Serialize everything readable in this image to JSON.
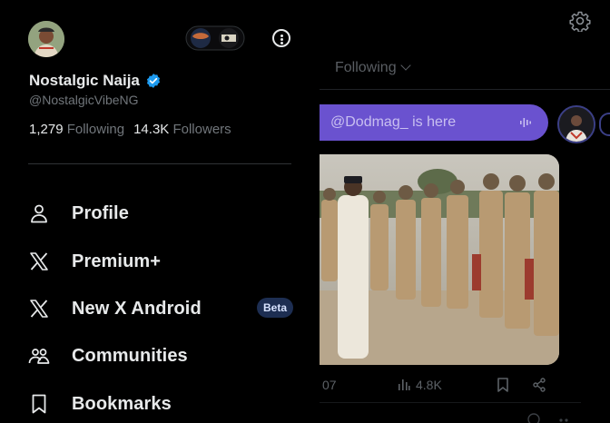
{
  "profile": {
    "display_name": "Nostalgic Naija",
    "handle": "@NostalgicVibeNG",
    "following_count": "1,279",
    "following_label": "Following",
    "followers_count": "14.3K",
    "followers_label": "Followers",
    "verified": true,
    "verified_color": "#1d9bf0"
  },
  "menu": {
    "items": [
      {
        "label": "Profile",
        "icon": "person-icon"
      },
      {
        "label": "Premium+",
        "icon": "x-logo-icon"
      },
      {
        "label": "New X Android",
        "icon": "x-logo-icon",
        "badge": "Beta"
      },
      {
        "label": "Communities",
        "icon": "communities-icon"
      },
      {
        "label": "Bookmarks",
        "icon": "bookmark-icon"
      }
    ]
  },
  "feed": {
    "tab_label": "Following",
    "space_banner": "@Dodmag_ is here",
    "post": {
      "stat_partial": "07",
      "views": "4.8K"
    }
  },
  "colors": {
    "background": "#000000",
    "text_primary": "#e7e9ea",
    "text_secondary": "#71767b",
    "space_banner": "#6a52cf",
    "beta_badge": "#1d2e52"
  }
}
